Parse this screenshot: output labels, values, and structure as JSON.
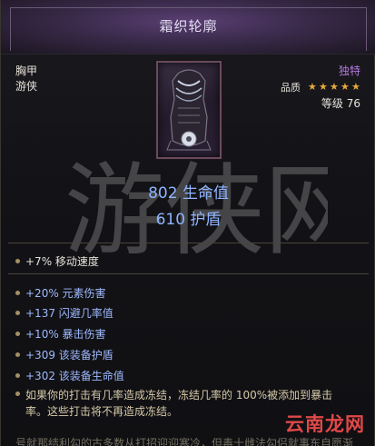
{
  "item": {
    "name": "霜织轮廓",
    "slot": "胸甲",
    "class": "游侠",
    "rarity": "独特",
    "quality_label": "品质",
    "quality_stars": 5,
    "level_label": "等级 76",
    "icon": "chest-armor-icon"
  },
  "main_stats": [
    "802 生命值",
    "610 护盾"
  ],
  "implicit": "+7% 移动速度",
  "affixes": [
    "+20% 元素伤害",
    "+137 闪避几率值",
    "+10% 暴击伤害",
    "+309 该装备护盾",
    "+302 该装备生命值"
  ],
  "unique_line1": "如果你的打击有几率造成冻结，冻结几率的 100%被添加到暴击",
  "unique_line2": "率。这些打击将不再造成冻结。",
  "watermark_text": "游侠网",
  "site_logo": "云南龙网",
  "cut_text": "号就那结利勾的古多数从打招迎迎寒冷，但毒十雌法勾侣就事东自愿渐",
  "colors": {
    "title_bg": "#3a2a4a",
    "rarity": "#b57ae0",
    "stat_blue": "#8fb4ff",
    "star": "#e7a93a"
  }
}
